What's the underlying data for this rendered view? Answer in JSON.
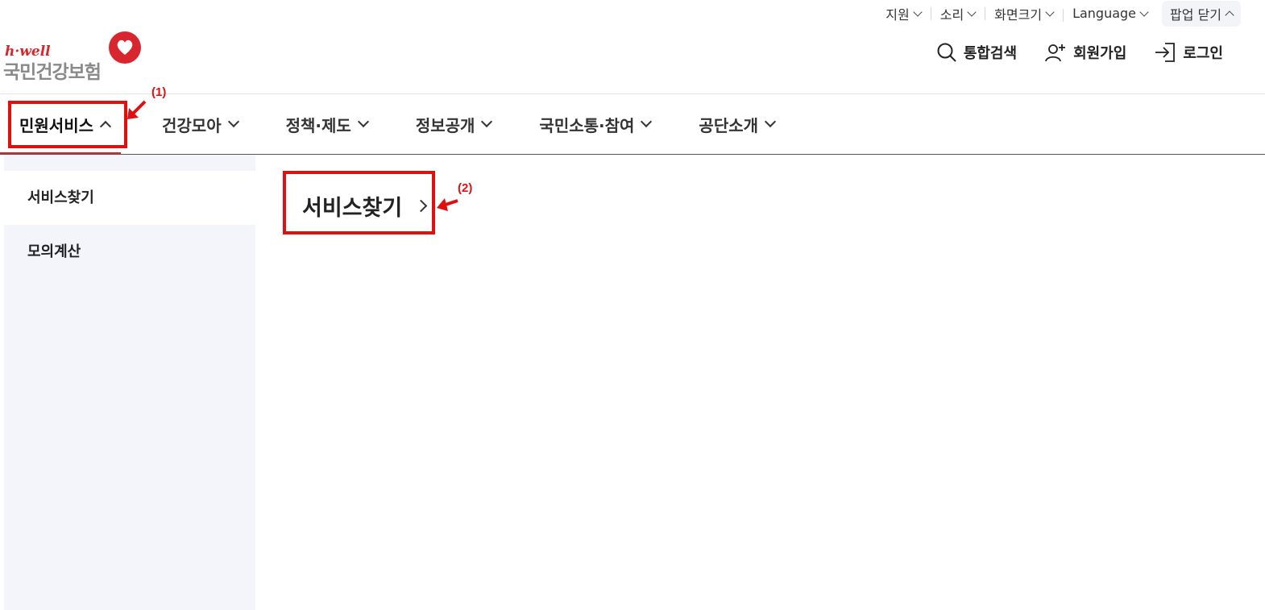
{
  "utility": {
    "items": [
      {
        "label": "지원"
      },
      {
        "label": "소리"
      },
      {
        "label": "화면크기"
      },
      {
        "label": "Language"
      },
      {
        "label": "팝업 닫기"
      }
    ]
  },
  "logo": {
    "tagline": "h·well",
    "name": "국민건강보험"
  },
  "header": {
    "search_label": "통합검색",
    "join_label": "회원가입",
    "login_label": "로그인"
  },
  "gnb": {
    "items": [
      {
        "label": "민원서비스"
      },
      {
        "label": "건강모아"
      },
      {
        "label": "정책·제도"
      },
      {
        "label": "정보공개"
      },
      {
        "label": "국민소통·참여"
      },
      {
        "label": "공단소개"
      }
    ]
  },
  "submenu": {
    "items": [
      {
        "label": "서비스찾기"
      },
      {
        "label": "모의계산"
      }
    ],
    "title": "서비스찾기"
  },
  "annotations": {
    "label1": "(1)",
    "label2": "(2)",
    "color": "#e01010"
  },
  "colors": {
    "brand_red": "#d9262e",
    "panel_bg": "#f4f5fa"
  }
}
